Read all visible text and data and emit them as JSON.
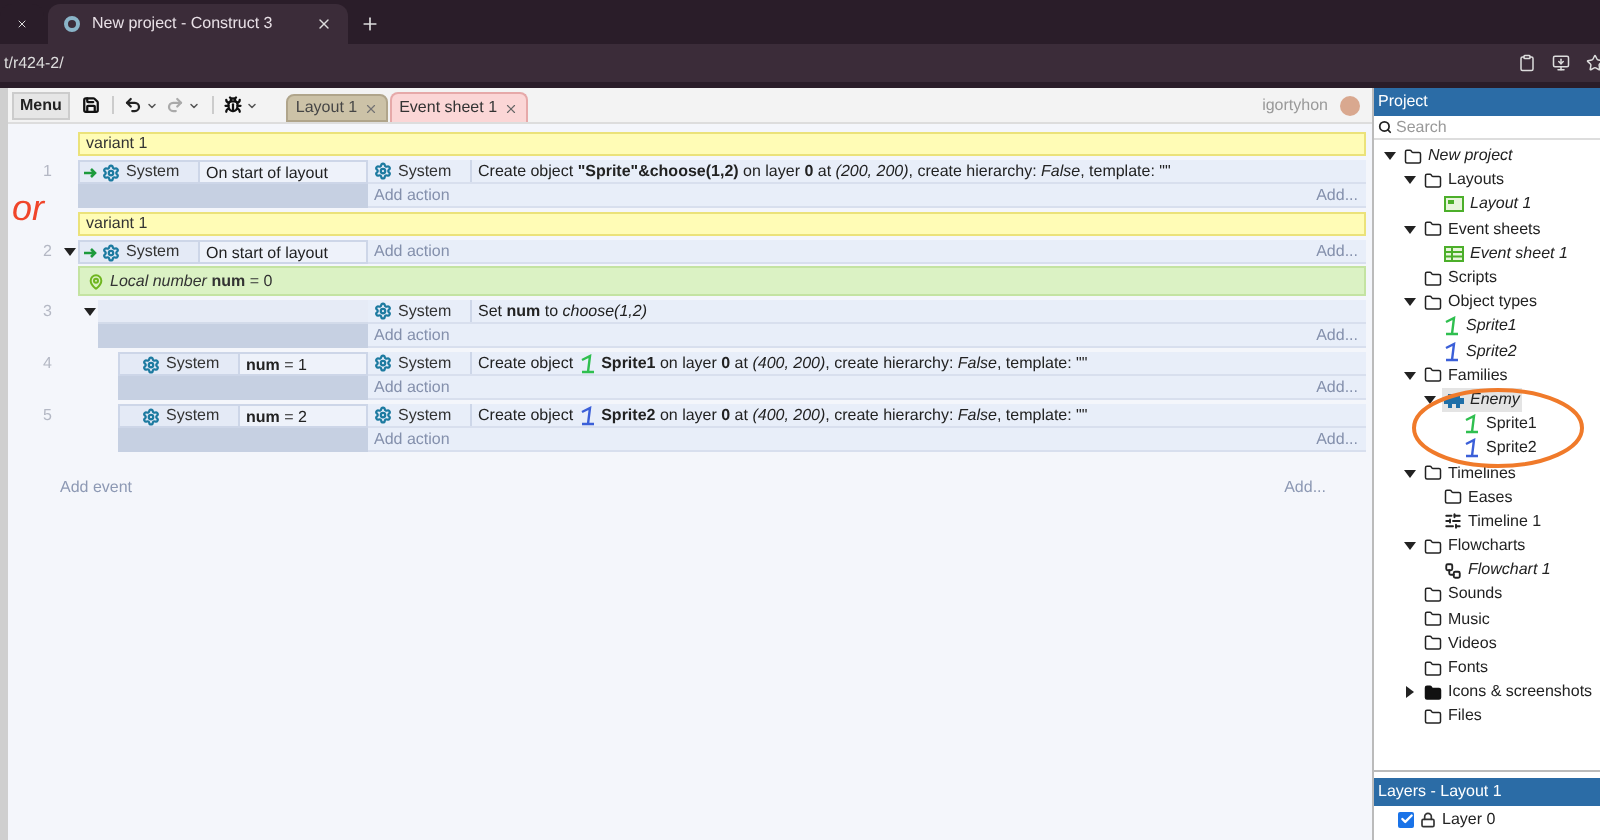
{
  "browser": {
    "tabs": [
      {
        "selected": false
      },
      {
        "label": "New project - Construct 3",
        "selected": true
      }
    ],
    "address": "t/r424-2/"
  },
  "toolbar": {
    "menu": "Menu",
    "tabs": [
      {
        "label": "Layout 1",
        "kind": "layout",
        "selected": false
      },
      {
        "label": "Event sheet 1",
        "kind": "eventsheet",
        "selected": true
      }
    ],
    "user": "igortyhon"
  },
  "annotation": {
    "text": "or"
  },
  "event_sheet": {
    "items": [
      {
        "kind": "comment",
        "text": "variant 1"
      },
      {
        "kind": "event",
        "number": "1",
        "conditions": [
          {
            "trigger": true,
            "object": "System",
            "text": "On start of layout"
          }
        ],
        "actions": [
          {
            "object": "System",
            "text": "Create object **\"Sprite\"&choose(1,2)** on layer **0** at *(200, 200)*, create hierarchy: *False*, template: \"\""
          }
        ],
        "add_action": "Add action",
        "add_more": "Add..."
      },
      {
        "kind": "comment",
        "text": "variant 1"
      },
      {
        "kind": "event",
        "number": "2",
        "expanded": true,
        "conditions": [
          {
            "trigger": true,
            "object": "System",
            "text": "On start of layout"
          }
        ],
        "add_action": "Add action",
        "add_more": "Add...",
        "children": [
          {
            "kind": "variable",
            "text": "*Local number* **num** = 0"
          },
          {
            "kind": "event",
            "number": "3",
            "expanded": true,
            "actions": [
              {
                "object": "System",
                "text": "Set **num** to *choose(1,2)*"
              }
            ],
            "add_action": "Add action",
            "add_more": "Add...",
            "children": [
              {
                "kind": "event",
                "number": "4",
                "conditions": [
                  {
                    "trigger": false,
                    "object": "System",
                    "text": "**num** = 1"
                  }
                ],
                "actions": [
                  {
                    "object": "System",
                    "prefix": "Create object",
                    "color": "#2fbf4f",
                    "text": "**Sprite1** on layer **0** at *(400, 200)*, create hierarchy: *False*, template: \"\""
                  }
                ],
                "add_action": "Add action",
                "add_more": "Add..."
              },
              {
                "kind": "event",
                "number": "5",
                "conditions": [
                  {
                    "trigger": false,
                    "object": "System",
                    "text": "**num** = 2"
                  }
                ],
                "actions": [
                  {
                    "object": "System",
                    "prefix": "Create object",
                    "color": "#3b5fd8",
                    "text": "**Sprite2** on layer **0** at *(400, 200)*, create hierarchy: *False*, template: \"\""
                  }
                ],
                "add_action": "Add action",
                "add_more": "Add..."
              }
            ]
          }
        ]
      }
    ],
    "add_event": "Add event",
    "add_more": "Add..."
  },
  "project": {
    "title": "Project",
    "search": {
      "placeholder": "Search"
    },
    "tree": [
      {
        "label": "New project",
        "kind": "project",
        "expanded": true,
        "selected": false,
        "children": [
          {
            "label": "Layouts",
            "kind": "folder",
            "expanded": true,
            "selected": false,
            "children": [
              {
                "label": "Layout 1",
                "kind": "layout",
                "selected": false
              }
            ]
          },
          {
            "label": "Event sheets",
            "kind": "folder",
            "expanded": true,
            "selected": false,
            "children": [
              {
                "label": "Event sheet 1",
                "kind": "eventsheet",
                "selected": false
              }
            ]
          },
          {
            "label": "Scripts",
            "kind": "folder",
            "selected": false
          },
          {
            "label": "Object types",
            "kind": "folder",
            "expanded": true,
            "selected": false,
            "children": [
              {
                "label": "Sprite1",
                "kind": "sprite",
                "color": "#2fbf4f",
                "selected": false
              },
              {
                "label": "Sprite2",
                "kind": "sprite",
                "color": "#3b5fd8",
                "selected": false
              }
            ]
          },
          {
            "label": "Families",
            "kind": "folder",
            "expanded": true,
            "selected": false,
            "children": [
              {
                "label": "Enemy",
                "kind": "family",
                "expanded": true,
                "selected": true,
                "children": [
                  {
                    "label": "Sprite1",
                    "kind": "member",
                    "color": "#2fbf4f",
                    "selected": false
                  },
                  {
                    "label": "Sprite2",
                    "kind": "member",
                    "color": "#3b5fd8",
                    "selected": false
                  }
                ]
              }
            ]
          },
          {
            "label": "Timelines",
            "kind": "folder",
            "expanded": true,
            "selected": false,
            "children": [
              {
                "label": "Eases",
                "kind": "folder",
                "selected": false
              },
              {
                "label": "Timeline 1",
                "kind": "timeline",
                "selected": false
              }
            ]
          },
          {
            "label": "Flowcharts",
            "kind": "folder",
            "expanded": true,
            "selected": false,
            "children": [
              {
                "label": "Flowchart 1",
                "kind": "flowchart",
                "selected": false
              }
            ]
          },
          {
            "label": "Sounds",
            "kind": "folder",
            "selected": false
          },
          {
            "label": "Music",
            "kind": "folder",
            "selected": false
          },
          {
            "label": "Videos",
            "kind": "folder",
            "selected": false
          },
          {
            "label": "Fonts",
            "kind": "folder",
            "selected": false
          },
          {
            "label": "Icons & screenshots",
            "kind": "folder-dark",
            "expanded": false,
            "selected": false
          },
          {
            "label": "Files",
            "kind": "folder",
            "selected": false
          }
        ]
      }
    ],
    "layers": {
      "title": "Layers - Layout 1",
      "items": [
        {
          "label": "Layer 0",
          "checked": true
        }
      ]
    }
  }
}
